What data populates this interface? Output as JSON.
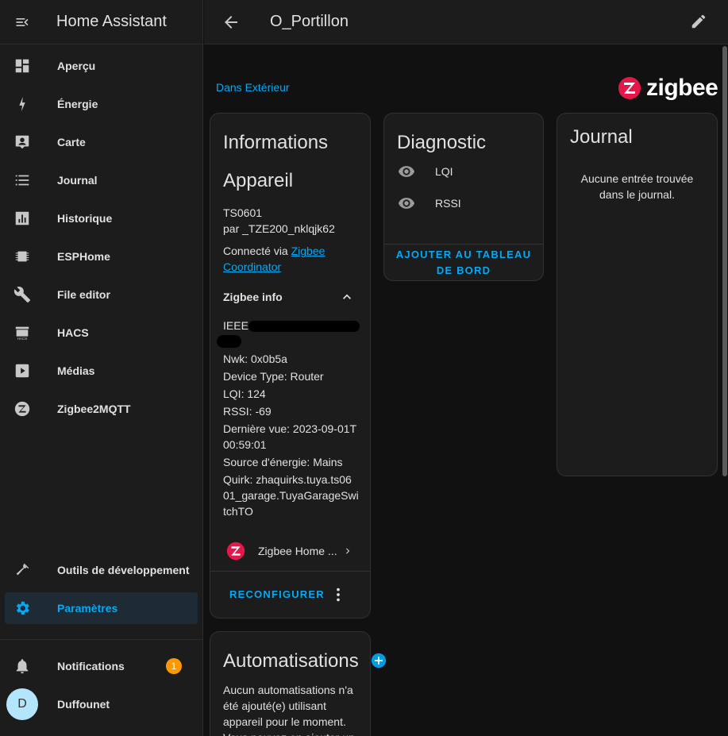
{
  "app": {
    "title": "Home Assistant"
  },
  "sidebar": {
    "items": [
      {
        "label": "Aperçu",
        "icon": "dashboard-icon"
      },
      {
        "label": "Énergie",
        "icon": "lightning-icon"
      },
      {
        "label": "Carte",
        "icon": "map-account-icon"
      },
      {
        "label": "Journal",
        "icon": "list-icon"
      },
      {
        "label": "Historique",
        "icon": "chart-icon"
      },
      {
        "label": "ESPHome",
        "icon": "chip-icon"
      },
      {
        "label": "File editor",
        "icon": "wrench-icon"
      },
      {
        "label": "HACS",
        "icon": "hacs-icon"
      },
      {
        "label": "Médias",
        "icon": "play-box-icon"
      },
      {
        "label": "Zigbee2MQTT",
        "icon": "zigbee-icon"
      }
    ],
    "bottom_items": [
      {
        "label": "Outils de développement",
        "icon": "hammer-icon"
      },
      {
        "label": "Paramètres",
        "icon": "gear-icon"
      }
    ],
    "notifications": {
      "label": "Notifications",
      "count": "1"
    },
    "user": {
      "label": "Duffounet",
      "initial": "D"
    }
  },
  "header": {
    "title": "O_Portillon"
  },
  "area_link": "Dans Extérieur",
  "brand": {
    "name": "zigbee",
    "color": "#e5174a"
  },
  "device_info": {
    "title_line1": "Informations",
    "title_line2": "Appareil",
    "model": "TS0601",
    "manufacturer": "par _TZE200_nklqjk62",
    "connected_prefix": "Connecté via",
    "connected_link_line1": "Zigbee",
    "connected_link_line2": "Coordinator",
    "zigbee_info_label": "Zigbee info",
    "details": {
      "ieee": "IEEE:",
      "nwk": "Nwk: 0x0b5a",
      "device_type": "Device Type: Router",
      "lqi": "LQI: 124",
      "rssi": "RSSI: -69",
      "last_seen_1": "Dernière vue: 2023-09-01T",
      "last_seen_2": "00:59:01",
      "power_source": "Source d'énergie: Mains",
      "quirk_1": "Quirk: zhaquirks.tuya.ts06",
      "quirk_2": "01_garage.TuyaGarageSwi",
      "quirk_3": "tchTO"
    },
    "integration_label": "Zigbee Home ...",
    "reconfigure_button": "RECONFIGURER"
  },
  "diagnostic": {
    "title": "Diagnostic",
    "entities": [
      {
        "label": "LQI"
      },
      {
        "label": "RSSI"
      }
    ],
    "add_button_line1": "AJOUTER AU TABLEAU",
    "add_button_line2": "DE BORD"
  },
  "journal": {
    "title": "Journal",
    "empty_line1": "Aucune entrée trouvée",
    "empty_line2": "dans le journal."
  },
  "automations": {
    "title": "Automatisations",
    "text_1": "Aucun automatisations n'a",
    "text_2": "été ajouté(e) utilisant",
    "text_3": "appareil pour le moment.",
    "text_4": "Vous pouvez en ajouter un"
  },
  "colors": {
    "accent": "#03a9f4",
    "badge": "#ff9800",
    "background": "#111111",
    "card": "#1c1c1c"
  }
}
